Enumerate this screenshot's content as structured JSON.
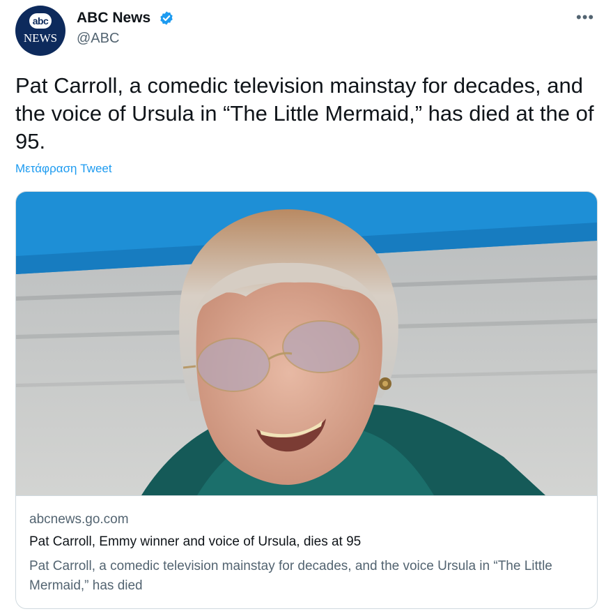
{
  "author": {
    "name": "ABC News",
    "handle": "@ABC",
    "verified": true,
    "avatar": {
      "logo_text": "abc",
      "label": "NEWS",
      "color": "#0d2a5c"
    }
  },
  "tweet": {
    "text": "Pat Carroll, a comedic television mainstay for decades, and the voice of Ursula in “The Little Mermaid,” has died at the of 95.",
    "translate_label": "Μετάφραση Tweet"
  },
  "card": {
    "image_icon": "portrait-photo",
    "domain": "abcnews.go.com",
    "title": "Pat Carroll, Emmy winner and voice of Ursula, dies at 95",
    "description": "Pat Carroll, a comedic television mainstay for decades, and the voice Ursula in “The Little Mermaid,” has died"
  },
  "icons": {
    "more": "more-options-icon",
    "verified": "verified-badge-icon"
  },
  "colors": {
    "link": "#1d9bf0",
    "secondary_text": "#536471",
    "primary_text": "#0f1419",
    "border": "#cfd9de"
  }
}
